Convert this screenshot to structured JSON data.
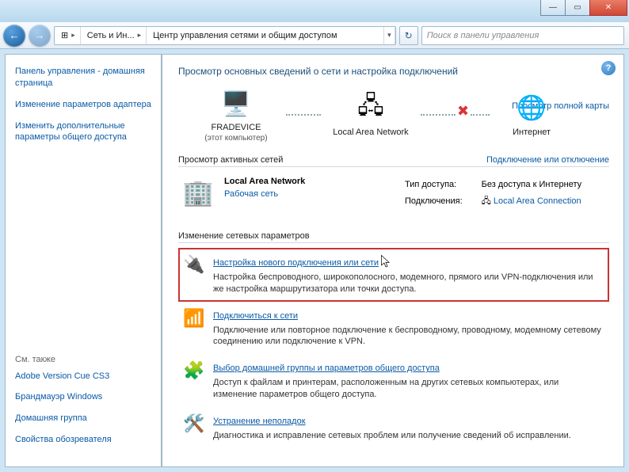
{
  "window": {
    "close": "✕",
    "max": "▭",
    "min": "—"
  },
  "nav": {
    "bc_icon": "⊞",
    "bc1": "Сеть и Ин...",
    "bc2": "Центр управления сетями и общим доступом",
    "search_ph": "Поиск в панели управления"
  },
  "side": {
    "l1": "Панель управления - домашняя страница",
    "l2": "Изменение параметров адаптера",
    "l3": "Изменить дополнительные параметры общего доступа",
    "see": "См. также",
    "s1": "Adobe Version Cue CS3",
    "s2": "Брандмауэр Windows",
    "s3": "Домашняя группа",
    "s4": "Свойства обозревателя"
  },
  "main": {
    "h1": "Просмотр основных сведений о сети и настройка подключений",
    "fullmap": "Просмотр полной карты",
    "n1": "FRADEVICE",
    "n1s": "(этот компьютер)",
    "n2": "Local Area Network",
    "n3": "Интернет",
    "sec1": "Просмотр активных сетей",
    "sec1a": "Подключение или отключение",
    "an_name": "Local Area Network",
    "an_type": "Рабочая сеть",
    "p_access_l": "Тип доступа:",
    "p_access_v": "Без доступа к Интернету",
    "p_conn_l": "Подключения:",
    "p_conn_v": "Local Area Connection",
    "sec2": "Изменение сетевых параметров",
    "t1": "Настройка нового подключения или сети",
    "t1d": "Настройка беспроводного, широкополосного, модемного, прямого или VPN-подключения или же настройка маршрутизатора или точки доступа.",
    "t2": "Подключиться к сети",
    "t2d": "Подключение или повторное подключение к беспроводному, проводному, модемному сетевому соединению или подключение к VPN.",
    "t3": "Выбор домашней группы и параметров общего доступа",
    "t3d": "Доступ к файлам и принтерам, расположенным на других сетевых компьютерах, или изменение параметров общего доступа.",
    "t4": "Устранение неполадок",
    "t4d": "Диагностика и исправление сетевых проблем или получение сведений об исправлении."
  }
}
